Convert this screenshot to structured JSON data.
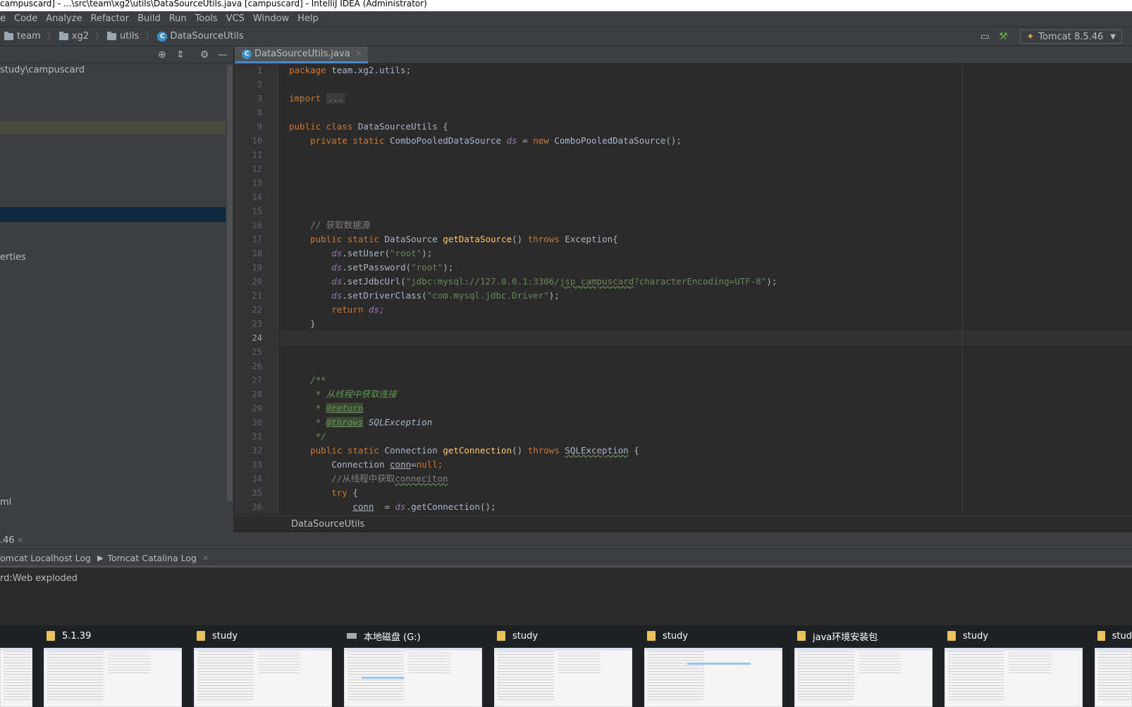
{
  "window": {
    "title": "campuscard] - ...\\src\\team\\xg2\\utils\\DataSourceUtils.java [campuscard] - IntelliJ IDEA (Administrator)"
  },
  "menu": [
    "e",
    "Code",
    "Analyze",
    "Refactor",
    "Build",
    "Run",
    "Tools",
    "VCS",
    "Window",
    "Help"
  ],
  "breadcrumbs": [
    "team",
    "xg2",
    "utils",
    "DataSourceUtils"
  ],
  "run_config": {
    "label": "Tomcat 8.5.46"
  },
  "project_tree": {
    "root_path": "study\\campuscard",
    "item_erties": "erties",
    "item_ml": "ml",
    "item_46": ".46"
  },
  "editor": {
    "tab_label": "DataSourceUtils.java",
    "bottom_breadcrumb": "DataSourceUtils",
    "line_numbers": [
      "1",
      "2",
      "3",
      "8",
      "9",
      "10",
      "11",
      "12",
      "13",
      "14",
      "15",
      "16",
      "17",
      "18",
      "19",
      "20",
      "21",
      "22",
      "23",
      "24",
      "25",
      "26",
      "27",
      "28",
      "29",
      "30",
      "31",
      "32",
      "33",
      "34",
      "35",
      "36"
    ],
    "current_line": "24"
  },
  "code": {
    "package_kw": "package",
    "package_name": " team.xg2.utils;",
    "import_kw": "import",
    "import_dots": "...",
    "public_kw": "public",
    "class_kw": "class",
    "class_name": " DataSourceUtils {",
    "private_kw": "private",
    "static_kw": "static",
    "cpds_type": "ComboPooledDataSource",
    "ds": "ds",
    "eq": " = ",
    "new_kw": "new",
    "cpds_ctor": " ComboPooledDataSource();",
    "comment_get_ds": "// 获取数据源",
    "datasource_type": " DataSource ",
    "get_ds_fn": "getDataSource",
    "paren_empty": "() ",
    "throws_kw": "throws",
    "exception": " Exception{",
    "set_user": ".setUser(",
    "root_str": "\"root\"",
    "close_stmt": ");",
    "set_password": ".setPassword(",
    "set_jdbc": ".setJdbcUrl(",
    "jdbc_url_a": "\"jdbc:mysql://127.0.0.1:3306/",
    "jdbc_url_b": "jsp_campuscard",
    "jdbc_url_c": "?characterEncoding=UTF-8\"",
    "set_driver": ".setDriverClass(",
    "driver_str": "\"com.mysql.jdbc.Driver\"",
    "return_kw": "return",
    "ds_semicolon": "ds;",
    "close_brace": "}",
    "doc_open": "/**",
    "doc_line1": " * 从线程中获取连接",
    "doc_star": " * ",
    "doc_return": "@return",
    "doc_throws": "@throws",
    "doc_sqlex": " SQLException",
    "doc_close": " */",
    "connection_type": " Connection ",
    "get_conn_fn": "getConnection",
    "sqlexception": "SQLException",
    "open_brace": " {",
    "conn_decl_type": "Connection ",
    "conn_var": "conn",
    "eq_null": "=",
    "null_kw": "null",
    "semicolon": ";",
    "comment_conn": "//从线程中获取",
    "comment_conn_word": "conneciton",
    "try_kw": "try",
    "conn_assign": "  = ",
    "get_connection_call": ".getConnection();"
  },
  "run_panel": {
    "tab_localhost": "omcat Localhost Log",
    "tab_catalina": "Tomcat Catalina Log",
    "console_text": "rd:Web exploded"
  },
  "taskbar_previews": [
    {
      "label": "",
      "icon": "folder"
    },
    {
      "label": "5.1.39",
      "icon": "folder"
    },
    {
      "label": "study",
      "icon": "folder"
    },
    {
      "label": "本地磁盘 (G:)",
      "icon": "drive"
    },
    {
      "label": "study",
      "icon": "folder"
    },
    {
      "label": "study",
      "icon": "folder"
    },
    {
      "label": "java环境安装包",
      "icon": "folder"
    },
    {
      "label": "study",
      "icon": "folder"
    },
    {
      "label": "stud",
      "icon": "folder"
    }
  ]
}
